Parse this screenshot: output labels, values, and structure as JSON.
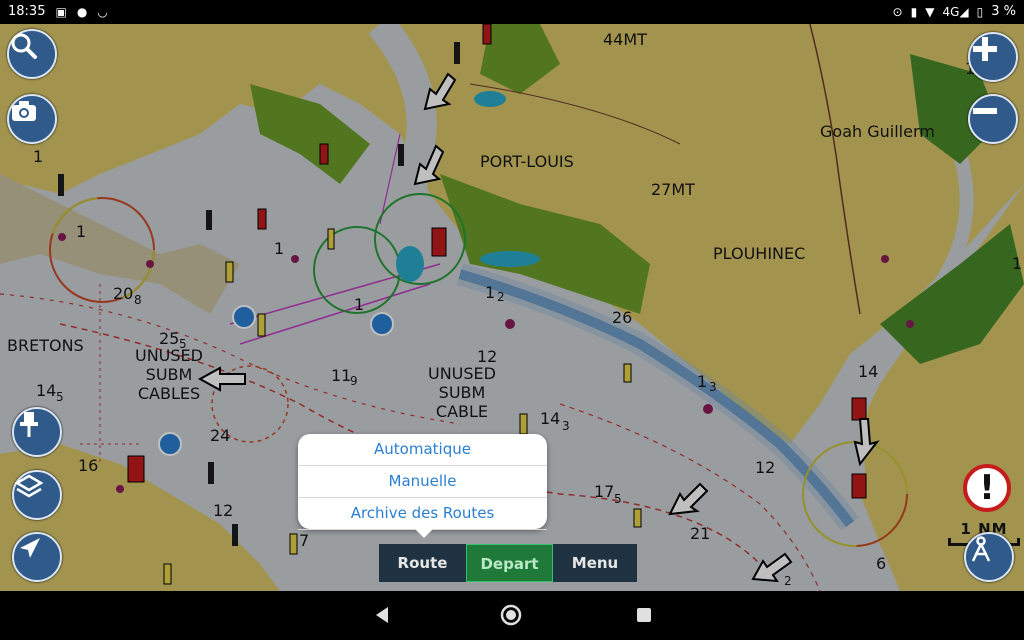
{
  "status_bar": {
    "time": "18:35",
    "left_icons": [
      "image-icon",
      "location-pin-icon",
      "smile-icon"
    ],
    "right_icons": [
      "location-icon",
      "vibrate-icon",
      "wifi-icon",
      "signal-4g-icon",
      "battery-icon"
    ],
    "network": "4G",
    "battery": "3 %"
  },
  "map": {
    "place_labels": [
      "44MT",
      "PORT-LOUIS",
      "27MT",
      "PLOUHINEC",
      "Goah Guillerm",
      "BRETONS"
    ],
    "area_labels": [
      {
        "lines": [
          "UNUSED",
          "SUBM",
          "CABLES"
        ]
      },
      {
        "lines": [
          "UNUSED",
          "SUBM",
          "CABLE"
        ]
      }
    ],
    "soundings": [
      "1",
      "1",
      "1",
      "1",
      "20",
      "8",
      "25",
      "5",
      "14",
      "5",
      "11",
      "9",
      "12",
      "1",
      "2",
      "26",
      "1",
      "3",
      "14",
      "3",
      "24",
      "16",
      "12",
      "7",
      "17",
      "5",
      "21",
      "12",
      "14",
      "6",
      "2",
      "1",
      "1"
    ],
    "scale_label": "1 NM"
  },
  "route_menu": {
    "items": [
      "Automatique",
      "Manuelle",
      "Archive des Routes"
    ]
  },
  "bottom_tabs": {
    "route": "Route",
    "depart": "Depart",
    "menu": "Menu"
  },
  "colors": {
    "land": "#d9c66a",
    "water": "#cdd2d6",
    "vegetation": "#6d9e2a",
    "accent_blue": "#2a7fd2",
    "fab_blue": "#2f5a8a",
    "depart_green": "#1f7a3a",
    "tab_dark": "#1e3242",
    "alert_red": "#c61c1c"
  }
}
